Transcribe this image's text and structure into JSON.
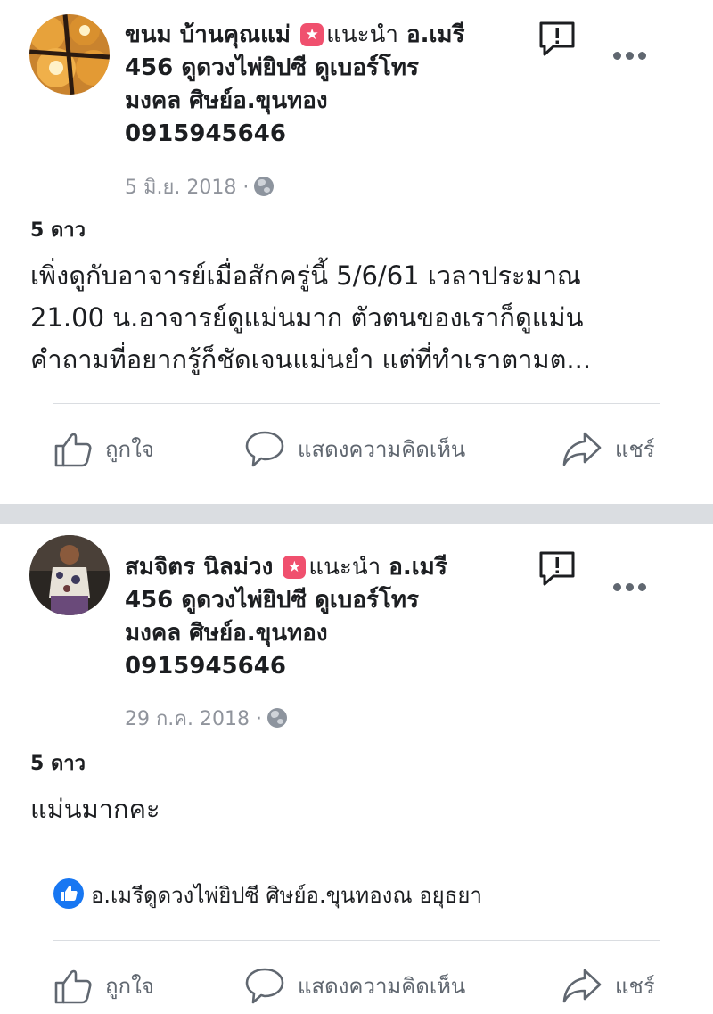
{
  "posts": [
    {
      "author": "ขนม บ้านคุณแม่",
      "recommends_label": "แนะนำ",
      "page_line1": "อ.เมรี",
      "page_line2": "456 ดูดวงไพ่ยิปซี ดูเบอร์โทร",
      "page_line3": "มงคล ศิษย์อ.ขุนทอง",
      "page_line4": "0915945646",
      "date": "5 มิ.ย. 2018 ·",
      "rating": "5 ดาว",
      "body": [
        "เพิ่งดูกับอาจารย์เมื่อสักครู่นี้ 5/6/61 เวลาประมาณ",
        "21.00 น.อาจารย์ดูแม่นมาก ตัวตนของเราก็ดูแม่น",
        "คำถามที่อยากรู้ก็ชัดเจนแม่นยำ แต่ที่ทำเราตามต..."
      ],
      "actions": {
        "like": "ถูกใจ",
        "comment": "แสดงความคิดเห็น",
        "share": "แชร์"
      }
    },
    {
      "author": "สมจิตร นิลม่วง",
      "recommends_label": "แนะนำ",
      "page_line1": "อ.เมรี",
      "page_line2": "456 ดูดวงไพ่ยิปซี ดูเบอร์โทร",
      "page_line3": "มงคล ศิษย์อ.ขุนทอง",
      "page_line4": "0915945646",
      "date": "29 ก.ค. 2018 ·",
      "rating": "5 ดาว",
      "body": [
        "แม่นมากคะ"
      ],
      "reactors": "อ.เมรีดูดวงไพ่ยิปซี ศิษย์อ.ขุนทองณ อยุธยา",
      "actions": {
        "like": "ถูกใจ",
        "comment": "แสดงความคิดเห็น",
        "share": "แชร์"
      }
    }
  ],
  "icons": {
    "recommend_badge": "star-badge-icon",
    "privacy": "globe-icon",
    "report": "report-icon",
    "more": "more-options-icon",
    "like": "thumbs-up-icon",
    "comment": "comment-bubble-icon",
    "share": "share-arrow-icon"
  },
  "colors": {
    "recommend_badge": "#f0506e",
    "like_badge": "#1877f2",
    "separator": "#dadde1",
    "muted_text": "#90949c",
    "action_text": "#606770"
  }
}
